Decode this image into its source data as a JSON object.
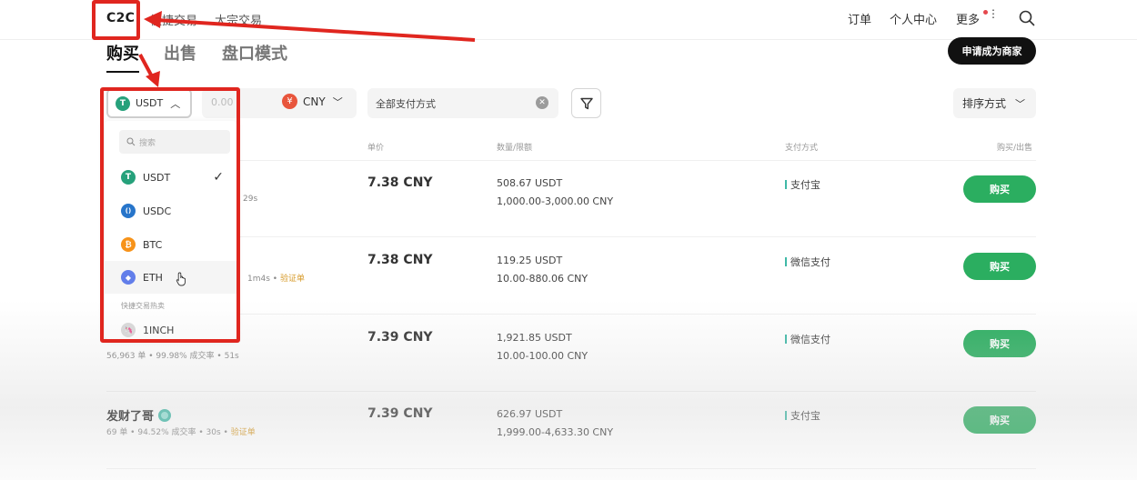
{
  "nav": {
    "brand": "C2C",
    "links": [
      "快捷交易",
      "大宗交易"
    ],
    "right": [
      "订单",
      "个人中心",
      "更多"
    ]
  },
  "tabs": [
    "购买",
    "出售",
    "盘口模式"
  ],
  "merchant_button": "申请成为商家",
  "filters": {
    "coin": "USDT",
    "amount_placeholder": "0.00",
    "currency": "CNY",
    "currency_symbol": "¥",
    "payment": "全部支付方式",
    "sort": "排序方式"
  },
  "table_headers": {
    "price": "单价",
    "quantity": "数量/限额",
    "payment": "支付方式",
    "action": "购买/出售"
  },
  "rows": [
    {
      "name": "",
      "stats": "29s",
      "price": "7.38 CNY",
      "qty": "508.67 USDT",
      "limit": "1,000.00-3,000.00 CNY",
      "method": "支付宝",
      "button": "购买"
    },
    {
      "name": "",
      "stats": "1m4s",
      "verify": "验证单",
      "price": "7.38 CNY",
      "qty": "119.25 USDT",
      "limit": "10.00-880.06 CNY",
      "method": "微信支付",
      "button": "购买"
    },
    {
      "name": "",
      "stats": "56,963 单  •  99.98% 成交率  •  51s",
      "price": "7.39 CNY",
      "qty": "1,921.85 USDT",
      "limit": "10.00-100.00 CNY",
      "method": "微信支付",
      "button": "购买"
    },
    {
      "name": "发财了哥",
      "stats": "69 单  •  94.52% 成交率  •  30s  •",
      "verify": "验证单",
      "price": "7.39 CNY",
      "qty": "626.97 USDT",
      "limit": "1,999.00-4,633.30 CNY",
      "method": "支付宝",
      "button": "购买"
    }
  ],
  "dropdown": {
    "search_placeholder": "搜索",
    "items": [
      {
        "symbol": "USDT",
        "color": "#26a17b",
        "glyph": "T",
        "selected": true
      },
      {
        "symbol": "USDC",
        "color": "#2775ca",
        "glyph": "()"
      },
      {
        "symbol": "BTC",
        "color": "#f7931a",
        "glyph": "₿"
      },
      {
        "symbol": "ETH",
        "color": "#627eea",
        "glyph": "◆"
      }
    ],
    "section_label": "快捷交易热卖",
    "extra_item": "1INCH"
  },
  "colors": {
    "buy_green": "#2bae60",
    "annotation_red": "#e0261f"
  }
}
